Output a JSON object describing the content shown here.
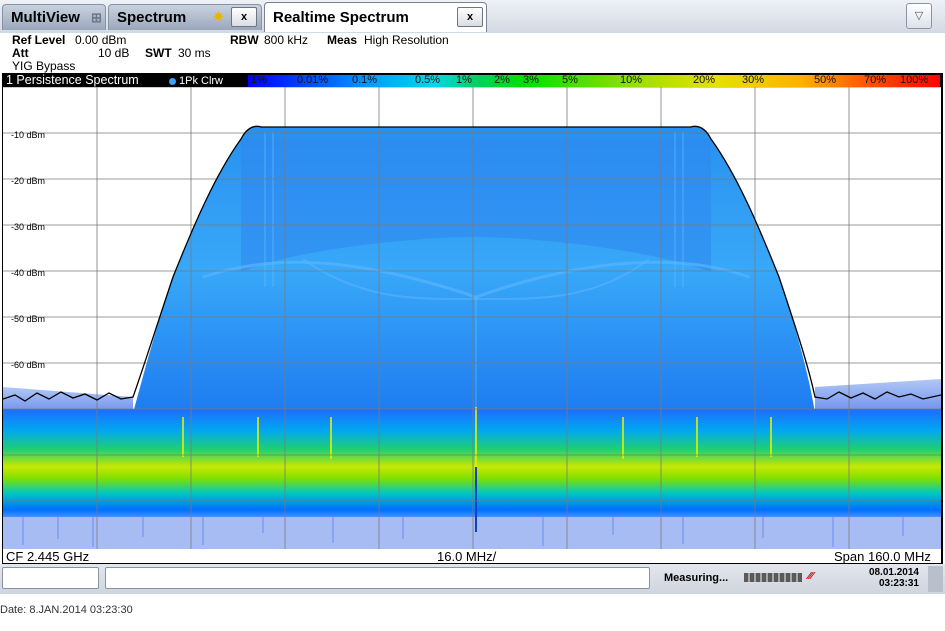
{
  "tabs": [
    {
      "label": "MultiView",
      "icon": "grid-icon"
    },
    {
      "label": "Spectrum",
      "icon": "star-icon",
      "close": "x"
    },
    {
      "label": "Realtime Spectrum",
      "close": "x",
      "active": true
    }
  ],
  "params": {
    "ref_level_label": "Ref Level",
    "ref_level_value": "0.00 dBm",
    "att_label": "Att",
    "att_value": "10 dB",
    "swt_label": "SWT",
    "swt_value": "30 ms",
    "rbw_label": "RBW",
    "rbw_value": "800 kHz",
    "meas_label": "Meas",
    "meas_value": "High Resolution",
    "yig": "YIG Bypass"
  },
  "window": {
    "title": "1 Persistence Spectrum",
    "trace": "1Pk Clrw",
    "colorbar_ticks": [
      "1%",
      "0.01%",
      "0.1%",
      "0.5%",
      "1%",
      "2%",
      "3%",
      "5%",
      "10%",
      "20%",
      "30%",
      "50%",
      "70%",
      "100%"
    ]
  },
  "y_axis": {
    "labels": [
      "-10 dBm",
      "-20 dBm",
      "-30 dBm",
      "-40 dBm",
      "-50 dBm",
      "-60 dBm"
    ]
  },
  "footer_bar": {
    "cf": "CF 2.445 GHz",
    "div": "16.0 MHz/",
    "span": "Span 160.0 MHz"
  },
  "status": {
    "measuring": "Measuring...",
    "date": "08.01.2014",
    "time": "03:23:31"
  },
  "page_footer": "Date: 8.JAN.2014  03:23:30",
  "colors": {
    "accent": "#0078ff",
    "trace": "#000000",
    "persistence_low": "#2a7cff",
    "persistence_high": "#d8e800"
  }
}
